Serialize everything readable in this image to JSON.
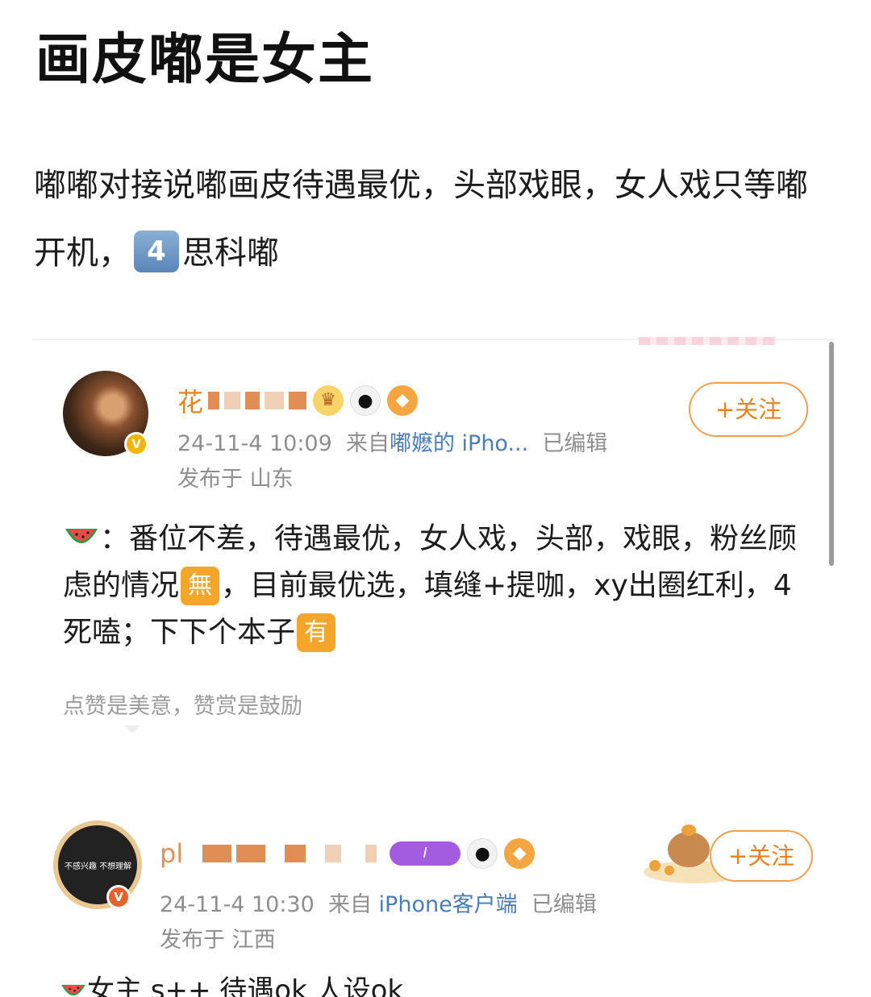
{
  "post": {
    "title": "画皮嘟是女主",
    "body_part1": "嘟嘟对接说嘟画皮待遇最优，头部戏眼，女人戏只等嘟开机，",
    "badge_number": "4",
    "body_part2": "思科嘟"
  },
  "comment1": {
    "username_visible": "花",
    "verified_icon": "verified-v-badge",
    "emojis": [
      "crown-icon",
      "panda-icon",
      "fish-icon"
    ],
    "timestamp": "24-11-4 10:09",
    "from_label": "来自",
    "source": "嘟嬷的 iPho...",
    "edited": "已编辑",
    "location_label": "发布于 山东",
    "follow_label": "+关注",
    "text_a": "：番位不差，待遇最优，女人戏，头部，戏眼，粉丝顾虑的情况",
    "tag1": "無",
    "text_b": "，目前最优选，填缝+提咖，xy出圈红利，4死嗑；下下个本子",
    "tag2": "有",
    "praise_text": "点赞是美意，赞赏是鼓励"
  },
  "comment2": {
    "username_visible": "pl",
    "avatar_text": "不感兴趣 不想理解",
    "level_badge": "I",
    "timestamp": "24-11-4 10:30",
    "from_label": "来自",
    "source": "iPhone客户端",
    "edited": "已编辑",
    "location_label": "发布于 江西",
    "follow_label": "+关注",
    "text": "女主 s++ 待遇ok 人设ok"
  },
  "colors": {
    "accent_orange": "#e8821e",
    "link_blue": "#4a7db5",
    "meta_gray": "#8e8e8e"
  }
}
